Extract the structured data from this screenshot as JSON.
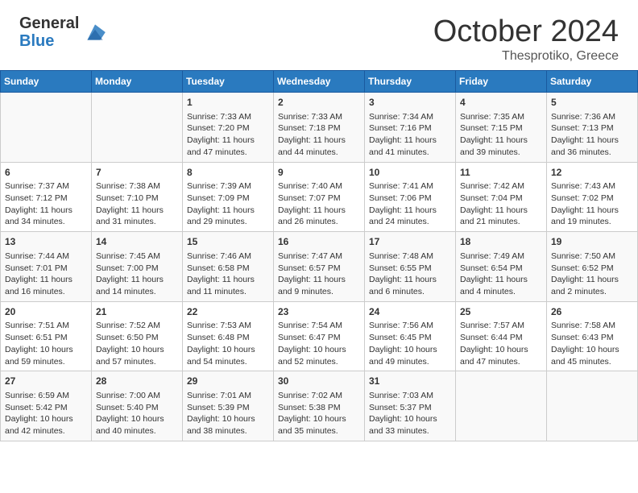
{
  "header": {
    "logo_general": "General",
    "logo_blue": "Blue",
    "month_title": "October 2024",
    "subtitle": "Thesprotiko, Greece"
  },
  "weekdays": [
    "Sunday",
    "Monday",
    "Tuesday",
    "Wednesday",
    "Thursday",
    "Friday",
    "Saturday"
  ],
  "weeks": [
    [
      {
        "day": "",
        "info": ""
      },
      {
        "day": "",
        "info": ""
      },
      {
        "day": "1",
        "info": "Sunrise: 7:33 AM\nSunset: 7:20 PM\nDaylight: 11 hours and 47 minutes."
      },
      {
        "day": "2",
        "info": "Sunrise: 7:33 AM\nSunset: 7:18 PM\nDaylight: 11 hours and 44 minutes."
      },
      {
        "day": "3",
        "info": "Sunrise: 7:34 AM\nSunset: 7:16 PM\nDaylight: 11 hours and 41 minutes."
      },
      {
        "day": "4",
        "info": "Sunrise: 7:35 AM\nSunset: 7:15 PM\nDaylight: 11 hours and 39 minutes."
      },
      {
        "day": "5",
        "info": "Sunrise: 7:36 AM\nSunset: 7:13 PM\nDaylight: 11 hours and 36 minutes."
      }
    ],
    [
      {
        "day": "6",
        "info": "Sunrise: 7:37 AM\nSunset: 7:12 PM\nDaylight: 11 hours and 34 minutes."
      },
      {
        "day": "7",
        "info": "Sunrise: 7:38 AM\nSunset: 7:10 PM\nDaylight: 11 hours and 31 minutes."
      },
      {
        "day": "8",
        "info": "Sunrise: 7:39 AM\nSunset: 7:09 PM\nDaylight: 11 hours and 29 minutes."
      },
      {
        "day": "9",
        "info": "Sunrise: 7:40 AM\nSunset: 7:07 PM\nDaylight: 11 hours and 26 minutes."
      },
      {
        "day": "10",
        "info": "Sunrise: 7:41 AM\nSunset: 7:06 PM\nDaylight: 11 hours and 24 minutes."
      },
      {
        "day": "11",
        "info": "Sunrise: 7:42 AM\nSunset: 7:04 PM\nDaylight: 11 hours and 21 minutes."
      },
      {
        "day": "12",
        "info": "Sunrise: 7:43 AM\nSunset: 7:02 PM\nDaylight: 11 hours and 19 minutes."
      }
    ],
    [
      {
        "day": "13",
        "info": "Sunrise: 7:44 AM\nSunset: 7:01 PM\nDaylight: 11 hours and 16 minutes."
      },
      {
        "day": "14",
        "info": "Sunrise: 7:45 AM\nSunset: 7:00 PM\nDaylight: 11 hours and 14 minutes."
      },
      {
        "day": "15",
        "info": "Sunrise: 7:46 AM\nSunset: 6:58 PM\nDaylight: 11 hours and 11 minutes."
      },
      {
        "day": "16",
        "info": "Sunrise: 7:47 AM\nSunset: 6:57 PM\nDaylight: 11 hours and 9 minutes."
      },
      {
        "day": "17",
        "info": "Sunrise: 7:48 AM\nSunset: 6:55 PM\nDaylight: 11 hours and 6 minutes."
      },
      {
        "day": "18",
        "info": "Sunrise: 7:49 AM\nSunset: 6:54 PM\nDaylight: 11 hours and 4 minutes."
      },
      {
        "day": "19",
        "info": "Sunrise: 7:50 AM\nSunset: 6:52 PM\nDaylight: 11 hours and 2 minutes."
      }
    ],
    [
      {
        "day": "20",
        "info": "Sunrise: 7:51 AM\nSunset: 6:51 PM\nDaylight: 10 hours and 59 minutes."
      },
      {
        "day": "21",
        "info": "Sunrise: 7:52 AM\nSunset: 6:50 PM\nDaylight: 10 hours and 57 minutes."
      },
      {
        "day": "22",
        "info": "Sunrise: 7:53 AM\nSunset: 6:48 PM\nDaylight: 10 hours and 54 minutes."
      },
      {
        "day": "23",
        "info": "Sunrise: 7:54 AM\nSunset: 6:47 PM\nDaylight: 10 hours and 52 minutes."
      },
      {
        "day": "24",
        "info": "Sunrise: 7:56 AM\nSunset: 6:45 PM\nDaylight: 10 hours and 49 minutes."
      },
      {
        "day": "25",
        "info": "Sunrise: 7:57 AM\nSunset: 6:44 PM\nDaylight: 10 hours and 47 minutes."
      },
      {
        "day": "26",
        "info": "Sunrise: 7:58 AM\nSunset: 6:43 PM\nDaylight: 10 hours and 45 minutes."
      }
    ],
    [
      {
        "day": "27",
        "info": "Sunrise: 6:59 AM\nSunset: 5:42 PM\nDaylight: 10 hours and 42 minutes."
      },
      {
        "day": "28",
        "info": "Sunrise: 7:00 AM\nSunset: 5:40 PM\nDaylight: 10 hours and 40 minutes."
      },
      {
        "day": "29",
        "info": "Sunrise: 7:01 AM\nSunset: 5:39 PM\nDaylight: 10 hours and 38 minutes."
      },
      {
        "day": "30",
        "info": "Sunrise: 7:02 AM\nSunset: 5:38 PM\nDaylight: 10 hours and 35 minutes."
      },
      {
        "day": "31",
        "info": "Sunrise: 7:03 AM\nSunset: 5:37 PM\nDaylight: 10 hours and 33 minutes."
      },
      {
        "day": "",
        "info": ""
      },
      {
        "day": "",
        "info": ""
      }
    ]
  ]
}
